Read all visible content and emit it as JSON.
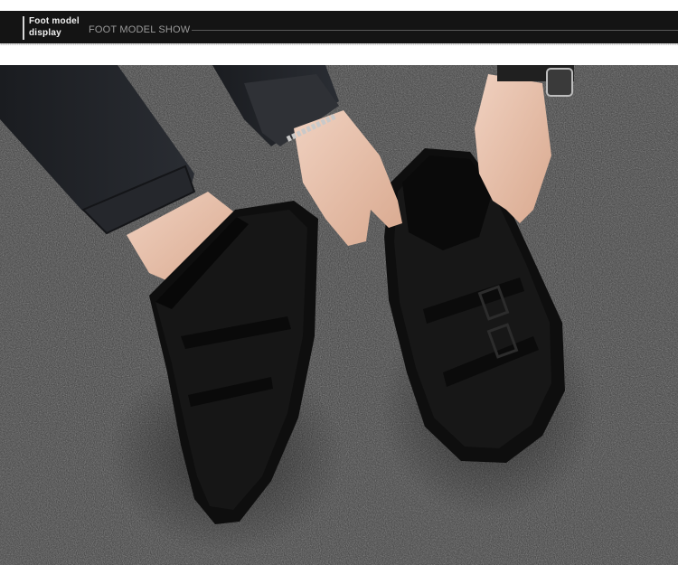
{
  "header": {
    "title": "Foot model display",
    "subtitle": "FOOT MODEL SHOW"
  },
  "photo": {
    "subject": "person in black jeans putting on black suede winter shoes on a grey carpet",
    "colors": {
      "carpet": "#3b3b3b",
      "shoe": "#151515",
      "jeans": "#1f2124",
      "skin": "#e9c5b2"
    }
  }
}
